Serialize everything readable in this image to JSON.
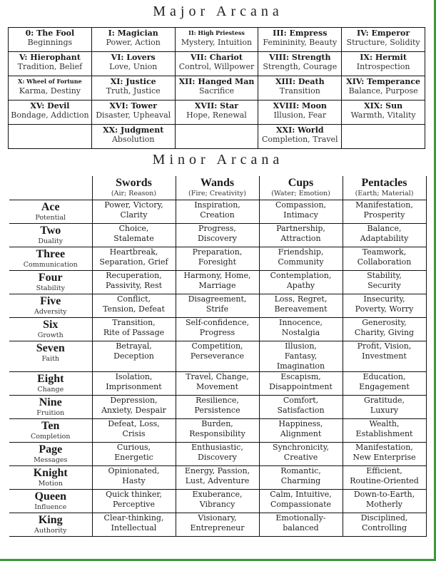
{
  "major": {
    "title": "Major Arcana",
    "rows": [
      [
        {
          "name": "0: The Fool",
          "meaning": "Beginnings"
        },
        {
          "name": "I: Magician",
          "meaning": "Power, Action"
        },
        {
          "name": "II: High Priestess",
          "meaning": "Mystery, Intuition"
        },
        {
          "name": "III: Empress",
          "meaning": "Femininity, Beauty"
        },
        {
          "name": "IV: Emperor",
          "meaning": "Structure, Solidity"
        }
      ],
      [
        {
          "name": "V: Hierophant",
          "meaning": "Tradition, Belief"
        },
        {
          "name": "VI: Lovers",
          "meaning": "Love, Union"
        },
        {
          "name": "VII: Chariot",
          "meaning": "Control, Willpower"
        },
        {
          "name": "VIII: Strength",
          "meaning": "Strength, Courage"
        },
        {
          "name": "IX: Hermit",
          "meaning": "Introspection"
        }
      ],
      [
        {
          "name": "X: Wheel of Fortune",
          "meaning": "Karma, Destiny"
        },
        {
          "name": "XI: Justice",
          "meaning": "Truth, Justice"
        },
        {
          "name": "XII: Hanged Man",
          "meaning": "Sacrifice"
        },
        {
          "name": "XIII: Death",
          "meaning": "Transition"
        },
        {
          "name": "XIV: Temperance",
          "meaning": "Balance, Purpose"
        }
      ],
      [
        {
          "name": "XV: Devil",
          "meaning": "Bondage, Addiction"
        },
        {
          "name": "XVI: Tower",
          "meaning": "Disaster, Upheaval"
        },
        {
          "name": "XVII: Star",
          "meaning": "Hope, Renewal"
        },
        {
          "name": "XVIII: Moon",
          "meaning": "Illusion, Fear"
        },
        {
          "name": "XIX: Sun",
          "meaning": "Warmth, Vitality"
        }
      ],
      [
        {
          "name": "",
          "meaning": ""
        },
        {
          "name": "XX: Judgment",
          "meaning": "Absolution"
        },
        {
          "name": "",
          "meaning": ""
        },
        {
          "name": "XXI: World",
          "meaning": "Completion, Travel"
        },
        {
          "name": "",
          "meaning": ""
        }
      ]
    ]
  },
  "minor": {
    "title": "Minor Arcana",
    "suits": [
      {
        "name": "Swords",
        "sub": "(Air; Reason)"
      },
      {
        "name": "Wands",
        "sub": "(Fire; Creativity)"
      },
      {
        "name": "Cups",
        "sub": "(Water; Emotion)"
      },
      {
        "name": "Pentacles",
        "sub": "(Earth; Material)"
      }
    ],
    "rows": [
      {
        "rank": "Ace",
        "theme": "Potential",
        "cells": [
          [
            "Power, Victory,",
            "Clarity"
          ],
          [
            "Inspiration,",
            "Creation"
          ],
          [
            "Compassion,",
            "Intimacy"
          ],
          [
            "Manifestation,",
            "Prosperity"
          ]
        ]
      },
      {
        "rank": "Two",
        "theme": "Duality",
        "cells": [
          [
            "Choice,",
            "Stalemate"
          ],
          [
            "Progress,",
            "Discovery"
          ],
          [
            "Partnership,",
            "Attraction"
          ],
          [
            "Balance,",
            "Adaptability"
          ]
        ]
      },
      {
        "rank": "Three",
        "theme": "Communication",
        "cells": [
          [
            "Heartbreak,",
            "Separation, Grief"
          ],
          [
            "Preparation,",
            "Foresight"
          ],
          [
            "Friendship,",
            "Community"
          ],
          [
            "Teamwork,",
            "Collaboration"
          ]
        ]
      },
      {
        "rank": "Four",
        "theme": "Stability",
        "cells": [
          [
            "Recuperation,",
            "Passivity, Rest"
          ],
          [
            "Harmony, Home,",
            "Marriage"
          ],
          [
            "Contemplation,",
            "Apathy"
          ],
          [
            "Stability,",
            "Security"
          ]
        ]
      },
      {
        "rank": "Five",
        "theme": "Adversity",
        "cells": [
          [
            "Conflict,",
            "Tension, Defeat"
          ],
          [
            "Disagreement,",
            "Strife"
          ],
          [
            "Loss, Regret,",
            "Bereavement"
          ],
          [
            "Insecurity,",
            "Poverty, Worry"
          ]
        ]
      },
      {
        "rank": "Six",
        "theme": "Growth",
        "cells": [
          [
            "Transition,",
            "Rite of Passage"
          ],
          [
            "Self-confidence,",
            "Progress"
          ],
          [
            "Innocence,",
            "Nostalgia"
          ],
          [
            "Generosity,",
            "Charity, Giving"
          ]
        ]
      },
      {
        "rank": "Seven",
        "theme": "Faith",
        "cells": [
          [
            "Betrayal,",
            "Deception"
          ],
          [
            "Competition,",
            "Perseverance"
          ],
          [
            "Illusion,",
            "Fantasy,",
            "Imagination"
          ],
          [
            "Profit, Vision,",
            "Investment"
          ]
        ]
      },
      {
        "rank": "Eight",
        "theme": "Change",
        "cells": [
          [
            "Isolation,",
            "Imprisonment"
          ],
          [
            "Travel, Change,",
            "Movement"
          ],
          [
            "Escapism,",
            "Disappointment"
          ],
          [
            "Education,",
            "Engagement"
          ]
        ]
      },
      {
        "rank": "Nine",
        "theme": "Fruition",
        "cells": [
          [
            "Depression,",
            "Anxiety, Despair"
          ],
          [
            "Resilience,",
            "Persistence"
          ],
          [
            "Comfort,",
            "Satisfaction"
          ],
          [
            "Gratitude,",
            "Luxury"
          ]
        ]
      },
      {
        "rank": "Ten",
        "theme": "Completion",
        "cells": [
          [
            "Defeat, Loss,",
            "Crisis"
          ],
          [
            "Burden,",
            "Responsibility"
          ],
          [
            "Happiness,",
            "Alignment"
          ],
          [
            "Wealth,",
            "Establishment"
          ]
        ]
      },
      {
        "rank": "Page",
        "theme": "Messages",
        "cells": [
          [
            "Curious,",
            "Energetic"
          ],
          [
            "Enthusiastic,",
            "Discovery"
          ],
          [
            "Synchronicity,",
            "Creative"
          ],
          [
            "Manifestation,",
            "New Enterprise"
          ]
        ]
      },
      {
        "rank": "Knight",
        "theme": "Motion",
        "cells": [
          [
            "Opinionated,",
            "Hasty"
          ],
          [
            "Energy, Passion,",
            "Lust, Adventure"
          ],
          [
            "Romantic,",
            "Charming"
          ],
          [
            "Efficient,",
            "Routine-Oriented"
          ]
        ]
      },
      {
        "rank": "Queen",
        "theme": "Influence",
        "cells": [
          [
            "Quick thinker,",
            "Perceptive"
          ],
          [
            "Exuberance,",
            "Vibrancy"
          ],
          [
            "Calm, Intuitive,",
            "Compassionate"
          ],
          [
            "Down-to-Earth,",
            "Motherly"
          ]
        ]
      },
      {
        "rank": "King",
        "theme": "Authority",
        "cells": [
          [
            "Clear-thinking,",
            "Intellectual"
          ],
          [
            "Visionary,",
            "Entrepreneur"
          ],
          [
            "Emotionally-",
            "balanced"
          ],
          [
            "Disciplined,",
            "Controlling"
          ]
        ]
      }
    ]
  }
}
